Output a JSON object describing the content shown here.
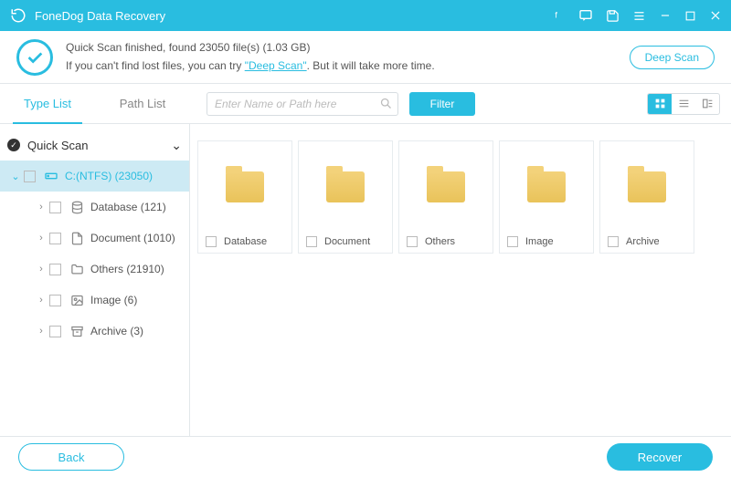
{
  "app": {
    "title": "FoneDog Data Recovery"
  },
  "status": {
    "line1": "Quick Scan finished, found 23050 file(s) (1.03 GB)",
    "line2a": "If you can't find lost files, you can try ",
    "deep_link": "\"Deep Scan\"",
    "line2b": ". But it will take more time.",
    "deep_button": "Deep Scan"
  },
  "tabs": {
    "type": "Type List",
    "path": "Path List"
  },
  "search": {
    "placeholder": "Enter Name or Path here"
  },
  "filter": "Filter",
  "tree": {
    "root": "Quick Scan",
    "drive": "C:(NTFS) (23050)",
    "items": [
      {
        "label": "Database (121)"
      },
      {
        "label": "Document (1010)"
      },
      {
        "label": "Others (21910)"
      },
      {
        "label": "Image (6)"
      },
      {
        "label": "Archive (3)"
      }
    ]
  },
  "grid": [
    {
      "label": "Database"
    },
    {
      "label": "Document"
    },
    {
      "label": "Others"
    },
    {
      "label": "Image"
    },
    {
      "label": "Archive"
    }
  ],
  "footer": {
    "back": "Back",
    "recover": "Recover"
  }
}
